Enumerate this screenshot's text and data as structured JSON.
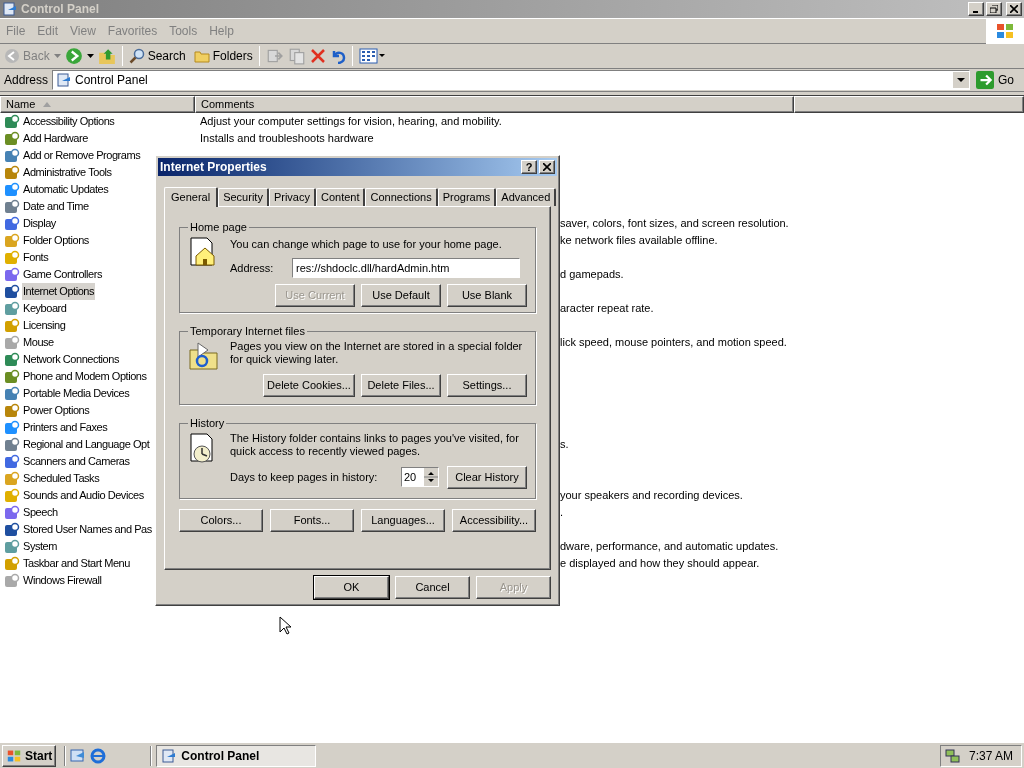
{
  "window": {
    "title": "Control Panel"
  },
  "menu": [
    "File",
    "Edit",
    "View",
    "Favorites",
    "Tools",
    "Help"
  ],
  "toolbar": {
    "back": {
      "label": "Back",
      "disabled": true
    },
    "search": "Search",
    "folders": "Folders"
  },
  "address": {
    "label": "Address",
    "value": "Control Panel",
    "go": "Go"
  },
  "columns": [
    {
      "label": "Name",
      "sorted": true
    },
    {
      "label": "Comments",
      "sorted": false
    }
  ],
  "items": [
    {
      "name": "Accessibility Options",
      "comment": "Adjust your computer settings for vision, hearing, and mobility.",
      "selected": false
    },
    {
      "name": "Add Hardware",
      "comment": "Installs and troubleshoots hardware",
      "selected": false
    },
    {
      "name": "Add or Remove Programs",
      "selected": false
    },
    {
      "name": "Administrative Tools",
      "selected": false
    },
    {
      "name": "Automatic Updates",
      "selected": false
    },
    {
      "name": "Date and Time",
      "selected": false
    },
    {
      "name": "Display",
      "comment": "saver, colors, font sizes, and screen resolution.",
      "covered": true,
      "selected": false
    },
    {
      "name": "Folder Options",
      "comment": "ke network files available offline.",
      "covered": true,
      "selected": false
    },
    {
      "name": "Fonts",
      "selected": false
    },
    {
      "name": "Game Controllers",
      "comment": "d gamepads.",
      "covered": true,
      "selected": false
    },
    {
      "name": "Internet Options",
      "selected": true
    },
    {
      "name": "Keyboard",
      "comment": "aracter repeat rate.",
      "covered": true,
      "selected": false
    },
    {
      "name": "Licensing",
      "selected": false
    },
    {
      "name": "Mouse",
      "comment": "lick speed, mouse pointers, and motion speed.",
      "covered": true,
      "selected": false
    },
    {
      "name": "Network Connections",
      "selected": false
    },
    {
      "name": "Phone and Modem Options",
      "selected": false
    },
    {
      "name": "Portable Media Devices",
      "selected": false
    },
    {
      "name": "Power Options",
      "selected": false
    },
    {
      "name": "Printers and Faxes",
      "selected": false
    },
    {
      "name": "Regional and Language Opt",
      "comment": "s.",
      "covered": true,
      "selected": false
    },
    {
      "name": "Scanners and Cameras",
      "selected": false
    },
    {
      "name": "Scheduled Tasks",
      "selected": false
    },
    {
      "name": "Sounds and Audio Devices",
      "comment": "your speakers and recording devices.",
      "covered": true,
      "selected": false
    },
    {
      "name": "Speech",
      "comment": ".",
      "covered": true,
      "selected": false
    },
    {
      "name": "Stored User Names and Pas",
      "selected": false
    },
    {
      "name": "System",
      "comment": "dware, performance, and automatic updates.",
      "covered": true,
      "selected": false
    },
    {
      "name": "Taskbar and Start Menu",
      "comment": "e displayed and how they should appear.",
      "covered": true,
      "selected": false
    },
    {
      "name": "Windows Firewall",
      "selected": false
    }
  ],
  "dialog": {
    "title": "Internet Properties",
    "help": "?",
    "tabs": [
      {
        "label": "General",
        "selected": true
      },
      {
        "label": "Security",
        "selected": false
      },
      {
        "label": "Privacy",
        "selected": false
      },
      {
        "label": "Content",
        "selected": false
      },
      {
        "label": "Connections",
        "selected": false
      },
      {
        "label": "Programs",
        "selected": false
      },
      {
        "label": "Advanced",
        "selected": false
      }
    ],
    "home_page": {
      "legend": "Home page",
      "text": "You can change which page to use for your home page.",
      "address_label": "Address:",
      "address_value": "res://shdoclc.dll/hardAdmin.htm",
      "buttons": [
        {
          "label": "Use Current",
          "disabled": true
        },
        {
          "label": "Use Default",
          "disabled": false
        },
        {
          "label": "Use Blank",
          "disabled": false
        }
      ]
    },
    "temp_files": {
      "legend": "Temporary Internet files",
      "text": "Pages you view on the Internet are stored in a special folder for quick viewing later.",
      "buttons": [
        {
          "label": "Delete Cookies...",
          "disabled": false
        },
        {
          "label": "Delete Files...",
          "disabled": false
        },
        {
          "label": "Settings...",
          "disabled": false
        }
      ]
    },
    "history": {
      "legend": "History",
      "text": "The History folder contains links to pages you've visited, for quick access to recently viewed pages.",
      "days_label": "Days to keep pages in history:",
      "days_value": "20",
      "clear": "Clear History"
    },
    "extra_buttons": [
      "Colors...",
      "Fonts...",
      "Languages...",
      "Accessibility..."
    ],
    "footer_buttons": [
      {
        "label": "OK",
        "disabled": false,
        "default": true
      },
      {
        "label": "Cancel",
        "disabled": false,
        "default": false
      },
      {
        "label": "Apply",
        "disabled": true,
        "default": false
      }
    ]
  },
  "taskbar": {
    "start": "Start",
    "task": "Control Panel",
    "clock": "7:37 AM"
  }
}
